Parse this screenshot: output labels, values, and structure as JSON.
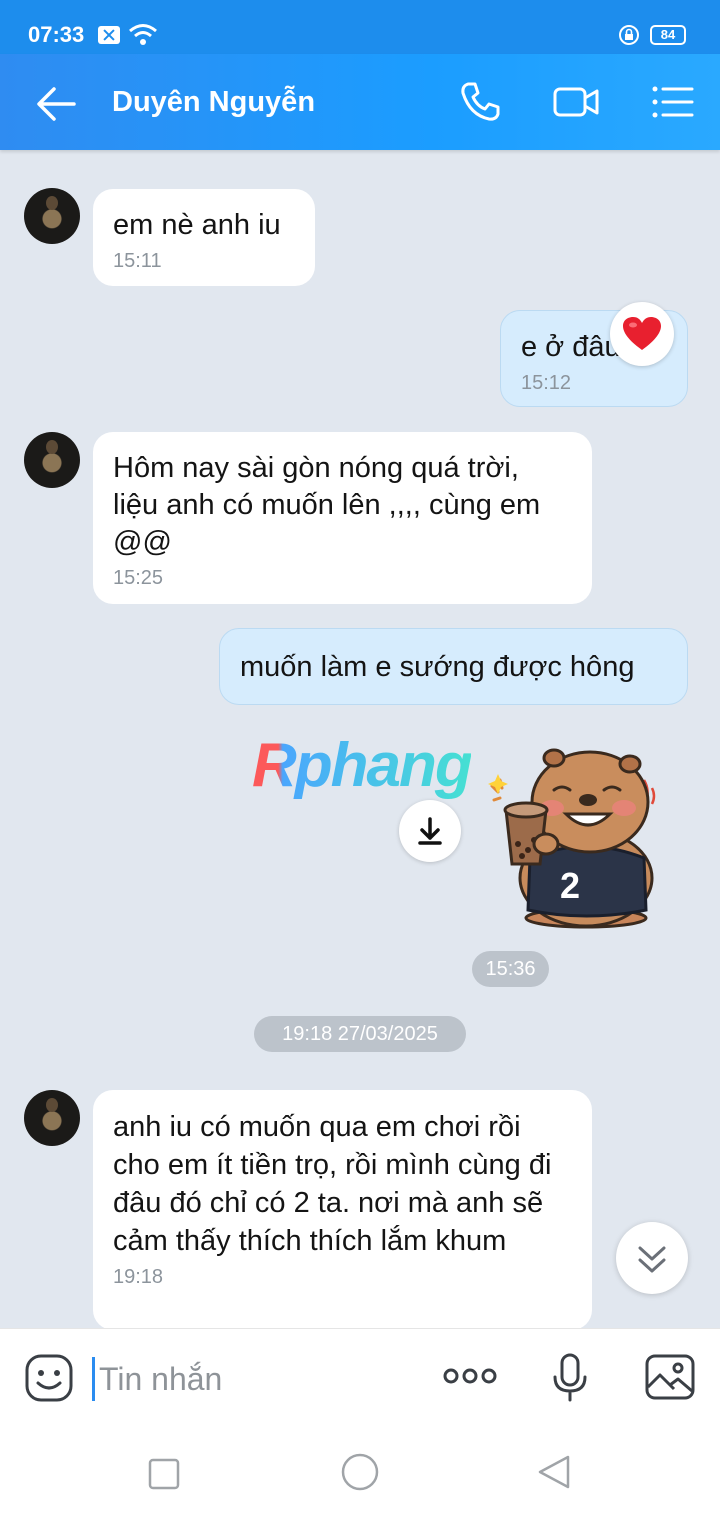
{
  "status_bar": {
    "time": "07:33",
    "battery": "84"
  },
  "header": {
    "contact_name": "Duyên Nguyễn"
  },
  "messages": [
    {
      "direction": "in",
      "text": "em nè anh iu",
      "time": "15:11"
    },
    {
      "direction": "out",
      "text": "e ở đâu nè",
      "time": "15:12",
      "reaction": "heart"
    },
    {
      "direction": "in",
      "text": "Hôm nay sài gòn nóng quá trời, liệu anh có muốn lên ,,,, cùng em @@",
      "time": "15:25"
    },
    {
      "direction": "out",
      "text": "muốn làm e sướng được hông"
    },
    {
      "direction": "in",
      "text": "anh iu có muốn qua em chơi rồi cho em ít tiền trọ, rồi mình cùng đi đâu đó chỉ có 2 ta. nơi mà anh sẽ cảm thấy thích thích lắm khum",
      "time": "19:18"
    }
  ],
  "sticker": {
    "time": "15:36",
    "shirt_text": "2"
  },
  "date_separator": "19:18 27/03/2025",
  "watermark": "Rphang",
  "input": {
    "placeholder": "Tin nhắn"
  },
  "colors": {
    "header": "#1b9dff",
    "outgoing_bubble": "#d6ecfd",
    "background": "#e1e7ef"
  }
}
